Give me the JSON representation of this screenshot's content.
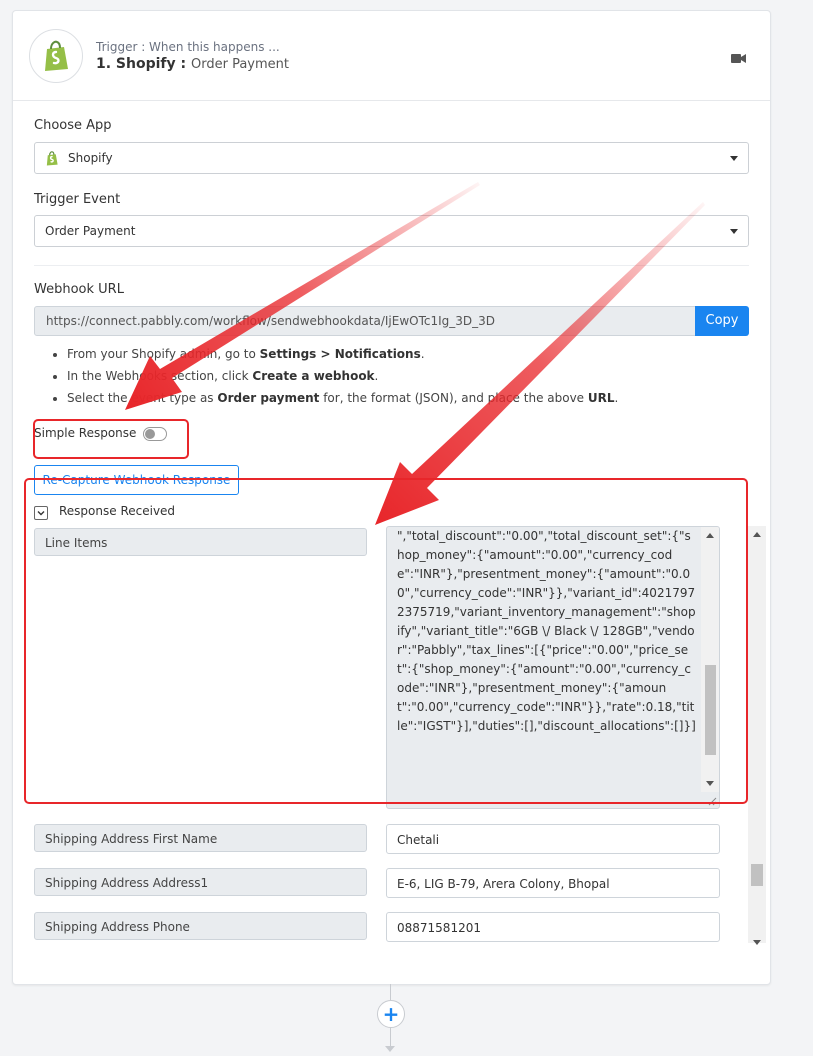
{
  "header": {
    "subtitle": "Trigger : When this happens ...",
    "step_title": "1. Shopify :",
    "event_name": "Order Payment"
  },
  "choose_app": {
    "label": "Choose App",
    "value": "Shopify"
  },
  "trigger_event": {
    "label": "Trigger Event",
    "value": "Order Payment"
  },
  "webhook": {
    "label": "Webhook URL",
    "url": "https://connect.pabbly.com/workflow/sendwebhookdata/IjEwOTc1Ig_3D_3D",
    "copy_label": "Copy",
    "instructions": [
      {
        "pre": "From your Shopify admin, go to ",
        "bold": "Settings > Notifications",
        "post": "."
      },
      {
        "pre": "In the Webhooks section, click ",
        "bold": "Create a webhook",
        "post": "."
      },
      {
        "pre": "Select the event type as ",
        "bold": "Order payment",
        "mid": " for, the format (JSON), and place the above ",
        "bold2": "URL",
        "post": "."
      }
    ]
  },
  "simple_response": {
    "label": "Simple Response",
    "enabled": false
  },
  "recapture_label": "Re-Capture Webhook Response",
  "response_received_label": "Response Received",
  "response_rows": [
    {
      "label": "Line Items",
      "value": "\",\"total_discount\":\"0.00\",\"total_discount_set\":{\"shop_money\":{\"amount\":\"0.00\",\"currency_code\":\"INR\"},\"presentment_money\":{\"amount\":\"0.00\",\"currency_code\":\"INR\"}},\"variant_id\":40217972375719,\"variant_inventory_management\":\"shopify\",\"variant_title\":\"6GB \\/ Black \\/ 128GB\",\"vendor\":\"Pabbly\",\"tax_lines\":[{\"price\":\"0.00\",\"price_set\":{\"shop_money\":{\"amount\":\"0.00\",\"currency_code\":\"INR\"},\"presentment_money\":{\"amount\":\"0.00\",\"currency_code\":\"INR\"}},\"rate\":0.18,\"title\":\"IGST\"}],\"duties\":[],\"discount_allocations\":[]}]"
    },
    {
      "label": "Shipping Address First Name",
      "value": "Chetali"
    },
    {
      "label": "Shipping Address Address1",
      "value": "E-6, LIG B-79, Arera Colony, Bhopal"
    },
    {
      "label": "Shipping Address Phone",
      "value": "08871581201"
    }
  ],
  "colors": {
    "accent": "#1a85f0",
    "shopify_green": "#95bf47",
    "highlight_red": "#e8262a"
  },
  "icons": {
    "app_logo": "shopify-bag-icon",
    "video": "video-camera-icon",
    "add_step": "plus-icon"
  }
}
